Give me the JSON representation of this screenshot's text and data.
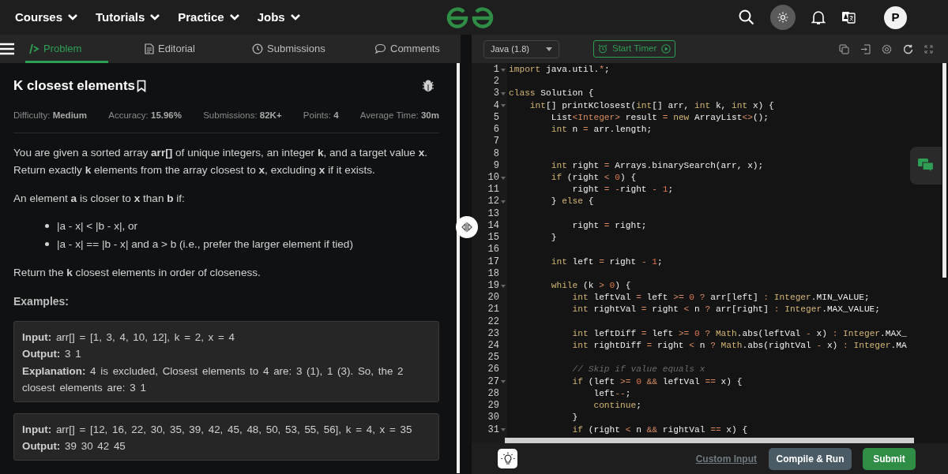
{
  "nav": {
    "menus": [
      "Courses",
      "Tutorials",
      "Practice",
      "Jobs"
    ],
    "avatar": "P"
  },
  "tabs": [
    {
      "label": "Problem",
      "selected": true
    },
    {
      "label": "Editorial",
      "selected": false
    },
    {
      "label": "Submissions",
      "selected": false
    },
    {
      "label": "Comments",
      "selected": false
    }
  ],
  "problem": {
    "title": "K closest elements",
    "meta": [
      {
        "label": "Difficulty:",
        "value": "Medium"
      },
      {
        "label": "Accuracy:",
        "value": "15.96%"
      },
      {
        "label": "Submissions:",
        "value": "82K+"
      },
      {
        "label": "Points:",
        "value": "4"
      },
      {
        "label": "Average Time:",
        "value": "30m"
      }
    ],
    "body": [
      {
        "kind": "para",
        "text": "You are given a sorted array **arr[]** of unique integers, an integer **k**, and a target value **x**. Return exactly **k** elements from the array closest to **x**, excluding **x** if it exists."
      },
      {
        "kind": "para",
        "text": "An element **a** is closer to **x** than **b** if:"
      },
      {
        "kind": "list",
        "items": [
          "|a - x| < |b - x|, or",
          "|a - x| == |b - x| and a > b (i.e., prefer the larger element if tied)"
        ]
      },
      {
        "kind": "para",
        "text": "Return the **k** closest elements in order of closeness."
      },
      {
        "kind": "heading",
        "text": "Examples:"
      }
    ],
    "examples": [
      [
        "**Input:** arr[] = [1, 3, 4, 10, 12], k = 2, x = 4",
        "**Output:** 3 1",
        "**Explanation:** 4 is excluded, Closest elements to 4 are: 3 (1), 1 (3). So, the 2 closest elements are: 3 1"
      ],
      [
        "**Input:** arr[] = [12, 16, 22, 30, 35, 39, 42, 45, 48, 50, 53, 55, 56], k = 4, x = 35",
        "**Output:** 39 30 42 45"
      ]
    ]
  },
  "editor": {
    "language": "Java (1.8)",
    "timer": "Start Timer",
    "lines": [
      {
        "n": "1",
        "fold": true,
        "tokens": [
          {
            "text": "import",
            "kind": "kw"
          },
          {
            "text": " java.util.",
            "kind": "plain"
          },
          {
            "text": "*",
            "kind": "op"
          },
          {
            "text": ";",
            "kind": "plain"
          }
        ]
      },
      {
        "n": "2",
        "fold": false
      },
      {
        "n": "3",
        "fold": true,
        "tokens": [
          {
            "text": "class",
            "kind": "kw"
          },
          {
            "text": " Solution {",
            "kind": "plain"
          }
        ]
      },
      {
        "n": "4",
        "fold": true,
        "tokens": [
          {
            "text": "    int",
            "kind": "kw"
          },
          {
            "text": "[] printKClosest(",
            "kind": "plain"
          },
          {
            "text": "int",
            "kind": "kw"
          },
          {
            "text": "[] arr, ",
            "kind": "plain"
          },
          {
            "text": "int",
            "kind": "kw"
          },
          {
            "text": " k, ",
            "kind": "plain"
          },
          {
            "text": "int",
            "kind": "kw"
          },
          {
            "text": " x) {",
            "kind": "plain"
          }
        ]
      },
      {
        "n": "5",
        "fold": false,
        "tokens": [
          {
            "text": "        List",
            "kind": "plain"
          },
          {
            "text": "<Integer>",
            "kind": "op"
          },
          {
            "text": " result ",
            "kind": "plain"
          },
          {
            "text": "=",
            "kind": "op"
          },
          {
            "text": " new",
            "kind": "kw"
          },
          {
            "text": " ArrayList",
            "kind": "plain"
          },
          {
            "text": "<>",
            "kind": "op"
          },
          {
            "text": "();",
            "kind": "plain"
          }
        ]
      },
      {
        "n": "6",
        "fold": false,
        "tokens": [
          {
            "text": "        int",
            "kind": "kw"
          },
          {
            "text": " n ",
            "kind": "plain"
          },
          {
            "text": "=",
            "kind": "op"
          },
          {
            "text": " arr.length;",
            "kind": "plain"
          }
        ]
      },
      {
        "n": "7",
        "fold": false
      },
      {
        "n": "8",
        "fold": false
      },
      {
        "n": "9",
        "fold": false,
        "tokens": [
          {
            "text": "        int",
            "kind": "kw"
          },
          {
            "text": " right ",
            "kind": "plain"
          },
          {
            "text": "=",
            "kind": "op"
          },
          {
            "text": " Arrays.binarySearch(arr, x);",
            "kind": "plain"
          }
        ]
      },
      {
        "n": "10",
        "fold": true,
        "tokens": [
          {
            "text": "        if",
            "kind": "kw"
          },
          {
            "text": " (right ",
            "kind": "plain"
          },
          {
            "text": "<",
            "kind": "op"
          },
          {
            "text": " 0",
            "kind": "num"
          },
          {
            "text": ") {",
            "kind": "plain"
          }
        ]
      },
      {
        "n": "11",
        "fold": false,
        "tokens": [
          {
            "text": "            right ",
            "kind": "plain"
          },
          {
            "text": "=",
            "kind": "op"
          },
          {
            "text": " -",
            "kind": "op"
          },
          {
            "text": "right ",
            "kind": "plain"
          },
          {
            "text": "-",
            "kind": "op"
          },
          {
            "text": " 1",
            "kind": "num"
          },
          {
            "text": ";",
            "kind": "plain"
          }
        ]
      },
      {
        "n": "12",
        "fold": true,
        "tokens": [
          {
            "text": "        } ",
            "kind": "plain"
          },
          {
            "text": "else",
            "kind": "kw"
          },
          {
            "text": " {",
            "kind": "plain"
          }
        ]
      },
      {
        "n": "13",
        "fold": false
      },
      {
        "n": "14",
        "fold": false,
        "tokens": [
          {
            "text": "            right ",
            "kind": "plain"
          },
          {
            "text": "=",
            "kind": "op"
          },
          {
            "text": " right;",
            "kind": "plain"
          }
        ]
      },
      {
        "n": "15",
        "fold": false,
        "tokens": [
          {
            "text": "        }",
            "kind": "plain"
          }
        ]
      },
      {
        "n": "16",
        "fold": false
      },
      {
        "n": "17",
        "fold": false,
        "tokens": [
          {
            "text": "        int",
            "kind": "kw"
          },
          {
            "text": " left ",
            "kind": "plain"
          },
          {
            "text": "=",
            "kind": "op"
          },
          {
            "text": " right ",
            "kind": "plain"
          },
          {
            "text": "-",
            "kind": "op"
          },
          {
            "text": " 1",
            "kind": "num"
          },
          {
            "text": ";",
            "kind": "plain"
          }
        ]
      },
      {
        "n": "18",
        "fold": false
      },
      {
        "n": "19",
        "fold": true,
        "tokens": [
          {
            "text": "        while",
            "kind": "kw"
          },
          {
            "text": " (k ",
            "kind": "plain"
          },
          {
            "text": ">",
            "kind": "op"
          },
          {
            "text": " 0",
            "kind": "num"
          },
          {
            "text": ") {",
            "kind": "plain"
          }
        ]
      },
      {
        "n": "20",
        "fold": false,
        "tokens": [
          {
            "text": "            int",
            "kind": "kw"
          },
          {
            "text": " leftVal ",
            "kind": "plain"
          },
          {
            "text": "=",
            "kind": "op"
          },
          {
            "text": " left ",
            "kind": "plain"
          },
          {
            "text": ">=",
            "kind": "op"
          },
          {
            "text": " 0",
            "kind": "num"
          },
          {
            "text": " ?",
            "kind": "op"
          },
          {
            "text": " arr[left] ",
            "kind": "plain"
          },
          {
            "text": ":",
            "kind": "op"
          },
          {
            "text": " Integer",
            "kind": "kw"
          },
          {
            "text": ".MIN_VALUE;",
            "kind": "plain"
          }
        ]
      },
      {
        "n": "21",
        "fold": false,
        "tokens": [
          {
            "text": "            int",
            "kind": "kw"
          },
          {
            "text": " rightVal ",
            "kind": "plain"
          },
          {
            "text": "=",
            "kind": "op"
          },
          {
            "text": " right ",
            "kind": "plain"
          },
          {
            "text": "<",
            "kind": "op"
          },
          {
            "text": " n ",
            "kind": "plain"
          },
          {
            "text": "?",
            "kind": "op"
          },
          {
            "text": " arr[right] ",
            "kind": "plain"
          },
          {
            "text": ":",
            "kind": "op"
          },
          {
            "text": " Integer",
            "kind": "kw"
          },
          {
            "text": ".MAX_VALUE;",
            "kind": "plain"
          }
        ]
      },
      {
        "n": "22",
        "fold": false
      },
      {
        "n": "23",
        "fold": false,
        "tokens": [
          {
            "text": "            int",
            "kind": "kw"
          },
          {
            "text": " leftDiff ",
            "kind": "plain"
          },
          {
            "text": "=",
            "kind": "op"
          },
          {
            "text": " left ",
            "kind": "plain"
          },
          {
            "text": ">=",
            "kind": "op"
          },
          {
            "text": " 0",
            "kind": "num"
          },
          {
            "text": " ?",
            "kind": "op"
          },
          {
            "text": " Math",
            "kind": "kw"
          },
          {
            "text": ".abs(leftVal ",
            "kind": "plain"
          },
          {
            "text": "-",
            "kind": "op"
          },
          {
            "text": " x) ",
            "kind": "plain"
          },
          {
            "text": ":",
            "kind": "op"
          },
          {
            "text": " Integer",
            "kind": "kw"
          },
          {
            "text": ".MAX_",
            "kind": "plain"
          }
        ]
      },
      {
        "n": "24",
        "fold": false,
        "tokens": [
          {
            "text": "            int",
            "kind": "kw"
          },
          {
            "text": " rightDiff ",
            "kind": "plain"
          },
          {
            "text": "=",
            "kind": "op"
          },
          {
            "text": " right ",
            "kind": "plain"
          },
          {
            "text": "<",
            "kind": "op"
          },
          {
            "text": " n ",
            "kind": "plain"
          },
          {
            "text": "?",
            "kind": "op"
          },
          {
            "text": " Math",
            "kind": "kw"
          },
          {
            "text": ".abs(rightVal ",
            "kind": "plain"
          },
          {
            "text": "-",
            "kind": "op"
          },
          {
            "text": " x) ",
            "kind": "plain"
          },
          {
            "text": ":",
            "kind": "op"
          },
          {
            "text": " Integer",
            "kind": "kw"
          },
          {
            "text": ".MA",
            "kind": "plain"
          }
        ]
      },
      {
        "n": "25",
        "fold": false
      },
      {
        "n": "26",
        "fold": false,
        "tokens": [
          {
            "text": "            // Skip if value equals x",
            "kind": "comment"
          }
        ]
      },
      {
        "n": "27",
        "fold": true,
        "tokens": [
          {
            "text": "            if",
            "kind": "kw"
          },
          {
            "text": " (left ",
            "kind": "plain"
          },
          {
            "text": ">=",
            "kind": "op"
          },
          {
            "text": " 0",
            "kind": "num"
          },
          {
            "text": " &&",
            "kind": "op"
          },
          {
            "text": " leftVal ",
            "kind": "plain"
          },
          {
            "text": "==",
            "kind": "op"
          },
          {
            "text": " x) {",
            "kind": "plain"
          }
        ]
      },
      {
        "n": "28",
        "fold": false,
        "tokens": [
          {
            "text": "                left",
            "kind": "plain"
          },
          {
            "text": "--",
            "kind": "op"
          },
          {
            "text": ";",
            "kind": "plain"
          }
        ]
      },
      {
        "n": "29",
        "fold": false,
        "tokens": [
          {
            "text": "                continue",
            "kind": "kw"
          },
          {
            "text": ";",
            "kind": "plain"
          }
        ]
      },
      {
        "n": "30",
        "fold": false,
        "tokens": [
          {
            "text": "            }",
            "kind": "plain"
          }
        ]
      },
      {
        "n": "31",
        "fold": true,
        "tokens": [
          {
            "text": "            if",
            "kind": "kw"
          },
          {
            "text": " (right ",
            "kind": "plain"
          },
          {
            "text": "<",
            "kind": "op"
          },
          {
            "text": " n ",
            "kind": "plain"
          },
          {
            "text": "&&",
            "kind": "op"
          },
          {
            "text": " rightVal ",
            "kind": "plain"
          },
          {
            "text": "==",
            "kind": "op"
          },
          {
            "text": " x) {",
            "kind": "plain"
          }
        ]
      }
    ],
    "custom_input": "Custom Input",
    "compile": "Compile & Run",
    "submit": "Submit"
  }
}
